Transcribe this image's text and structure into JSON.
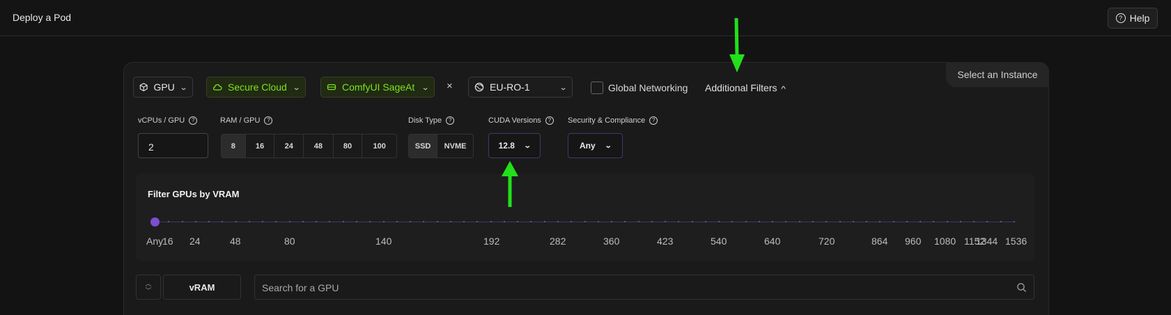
{
  "header": {
    "title": "Deploy a Pod",
    "help_label": "Help",
    "help_icon": "question-circle-icon"
  },
  "panel": {
    "select_instance": "Select an Instance"
  },
  "filters_bar": {
    "compute_type": {
      "label": "GPU",
      "icon": "cube-icon"
    },
    "cloud_type": {
      "label": "Secure Cloud",
      "icon": "cloud-icon",
      "color": "#7be31f"
    },
    "template": {
      "label": "ComfyUI SageAt",
      "icon": "drive-icon",
      "color": "#7be31f"
    },
    "clear": "×",
    "region": {
      "label": "EU-RO-1",
      "icon": "globe-icon"
    },
    "global_networking": {
      "label": "Global Networking",
      "checked": false
    },
    "additional_filters": "Additional Filters"
  },
  "additional": {
    "vcpus": {
      "label": "vCPUs / GPU",
      "value": "2"
    },
    "ram": {
      "label": "RAM / GPU",
      "options": [
        "8",
        "16",
        "24",
        "48",
        "80",
        "100"
      ],
      "selected": "8"
    },
    "disk": {
      "label": "Disk Type",
      "options": [
        "SSD",
        "NVME"
      ]
    },
    "cuda": {
      "label": "CUDA Versions",
      "value": "12.8"
    },
    "security": {
      "label": "Security & Compliance",
      "value": "Any"
    }
  },
  "vram_filter": {
    "title": "Filter GPUs by VRAM",
    "ticks": [
      "Any",
      "16",
      "24",
      "48",
      "80",
      "140",
      "192",
      "282",
      "360",
      "423",
      "540",
      "640",
      "720",
      "864",
      "960",
      "1080",
      "1152",
      "1344",
      "1536"
    ],
    "selected": "Any",
    "accent": "#7b4fd1"
  },
  "list_controls": {
    "sort_label": "vRAM",
    "search_placeholder": "Search for a GPU"
  },
  "annotations": {
    "arrow_color": "#22e01a"
  }
}
